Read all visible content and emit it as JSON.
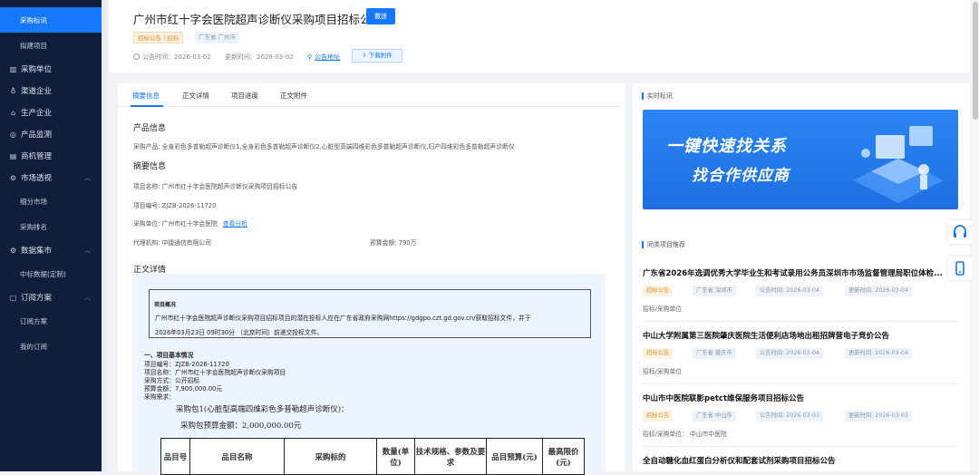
{
  "sidebar": {
    "items": [
      {
        "label": "采购标讯",
        "type": "sub",
        "active": true
      },
      {
        "label": "拟建项目",
        "type": "sub"
      },
      {
        "label": "采购单位",
        "icon": "bar-chart-icon"
      },
      {
        "label": "渠道企业",
        "icon": "share-icon"
      },
      {
        "label": "生产企业",
        "icon": "factory-icon"
      },
      {
        "label": "产品监测",
        "icon": "monitor-icon"
      },
      {
        "label": "商机管理",
        "icon": "briefcase-icon"
      },
      {
        "label": "市场透视",
        "icon": "gear-icon",
        "chevron": true
      },
      {
        "label": "细分市场",
        "type": "sub"
      },
      {
        "label": "采购排名",
        "type": "sub"
      },
      {
        "label": "数据集市",
        "icon": "database-icon",
        "chevron": true
      },
      {
        "label": "中标数据(定制)",
        "type": "sub"
      },
      {
        "label": "订阅方案",
        "icon": "subscribe-icon",
        "chevron": true
      },
      {
        "label": "订阅方案",
        "type": "sub"
      },
      {
        "label": "我的订阅",
        "type": "sub"
      }
    ]
  },
  "header": {
    "title": "广州市红十字会医院超声诊断仪采购项目招标公告",
    "subscribe_label": "撒迷",
    "tags": [
      "招标公告 | 招标",
      "广东省 广州市"
    ],
    "announce_time": "公告时间：2026-03-02",
    "update_time": "更新时间：2026-03-02",
    "address_link": "公告地址",
    "download_label": "下载附件"
  },
  "tabs": [
    "摘要信息",
    "正文详情",
    "项目进度",
    "正文附件"
  ],
  "product": {
    "heading": "产品信息",
    "line": "采购产品: 全身彩色多普勒超声诊断仪1,全身彩色多普勒超声诊断仪2,心脏型高端四维彩色多普勒超声诊断仪,妇产四维彩色多普勒超声诊断仪"
  },
  "summary": {
    "heading": "摘要信息",
    "project_name": "项目名称:  广州市红十字会医院超声诊断仪采购项目招标公告",
    "project_no": "项目编号:  ZJZB-2026-11720",
    "buyer": "采购单位:  广州市红十字会医院",
    "view_analysis": "查看分析",
    "agent": "代理机构:  中捷通信有限公司",
    "budget": "预算金额:  790万"
  },
  "body": {
    "heading": "正文详情",
    "box_title": "项目概况",
    "box_line1": "广州市红十字会医院超声诊断仪采购项目招标项目的潜在投标人应在广东省政府采购网https://gdgpo.czt.gd.gov.cn/获取招标文件，并于",
    "box_line2": "2026年03月23日 09时30分 （北京时间）前递交投标文件。",
    "s1": "一、项目基本情况",
    "l1": "项目编号：ZJZB-2026-11720",
    "l2": "项目名称：广州市红十字会医院超声诊断仪采购项目",
    "l3": "采购方式：公开招标",
    "l4": "预算金额：7,900,000.00元",
    "l5": "采购需求：",
    "pkg": "采购包1(心脏型高端四维彩色多普勒超声诊断仪)：",
    "pkg_budget": "采购包预算金额：2,000,000.00元",
    "table_headers": [
      "品目号",
      "品目名称",
      "采购标的",
      "数量(单位)",
      "技术规格、参数及要求",
      "品目预算(元)",
      "最高限价(元)"
    ]
  },
  "right": {
    "realtime_heading": "实时标讯",
    "banner_line1": "一键快速找关系",
    "banner_line2": "找合作供应商",
    "similar_heading": "同类项目推荐",
    "items": [
      {
        "title": "广东省2026年选调优秀大学毕业生和考试录用公务员深圳市市场监督管理局职位体检...",
        "tag": "招标公告",
        "region": "广东省 深圳市",
        "announce": "公告时间: 2026-03-04",
        "update": "更新时间: 2026-03-04",
        "unit": "招标/采购单位"
      },
      {
        "title": "中山大学附属第三医院肇庆医院生活便利店场地出租招牌营电子竞价公告",
        "tag": "招标公告",
        "region": "广东省 肇庆市",
        "announce": "公告时间: 2026-03-04",
        "update": "更新时间: 2026-03-04",
        "unit": "招标/采购单位"
      },
      {
        "title": "中山市中医院联影petct维保服务项目招标公告",
        "tag": "招标公告",
        "region": "广东省 中山市",
        "announce": "公告时间: 2026-03-03",
        "update": "更新时间: 2026-03-03",
        "unit": "招标/采购单位：  中山市中医院"
      },
      {
        "title": "全自动糖化血红蛋白分析仪和配套试剂采购项目招标公告"
      }
    ]
  },
  "colors": {
    "accent": "#1677ff",
    "sidebar_bg": "#0f1f3a",
    "tag_orange": "#e8912c"
  }
}
